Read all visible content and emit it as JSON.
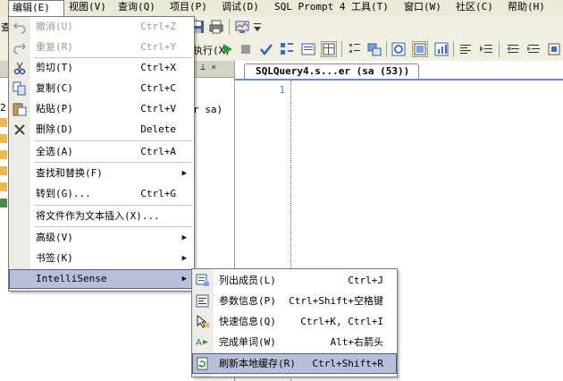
{
  "menubar": {
    "items": [
      "编辑(E)",
      "视图(V)",
      "查询(Q)",
      "项目(P)",
      "调试(D)",
      "SQL Prompt 4",
      "工具(T)",
      "窗口(W)",
      "社区(C)",
      "帮助(H)"
    ]
  },
  "toolbar": {
    "partial_left": "查",
    "execute_label": "执行(X)"
  },
  "left_panel": {
    "pin_glyph": "▾ ⊥ ×",
    "sa_text": "r sa)",
    "partial_label": "2"
  },
  "editor": {
    "tab_title": "SQLQuery4.s...er (sa (53))",
    "line_number": "1"
  },
  "edit_menu": {
    "items": [
      {
        "label": "撤消(U)",
        "shortcut": "Ctrl+Z",
        "icon": "undo-icon"
      },
      {
        "label": "重复(R)",
        "shortcut": "Ctrl+Y",
        "icon": "redo-icon"
      },
      {
        "label": "剪切(T)",
        "shortcut": "Ctrl+X",
        "icon": "cut-icon"
      },
      {
        "label": "复制(C)",
        "shortcut": "Ctrl+C",
        "icon": "copy-icon"
      },
      {
        "label": "粘贴(P)",
        "shortcut": "Ctrl+V",
        "icon": "paste-icon"
      },
      {
        "label": "删除(D)",
        "shortcut": "Delete",
        "icon": "delete-icon"
      },
      {
        "label": "全选(A)",
        "shortcut": "Ctrl+A"
      },
      {
        "label": "查找和替换(F)",
        "arrow": "▶"
      },
      {
        "label": "转到(G)...",
        "shortcut": "Ctrl+G"
      },
      {
        "label": "将文件作为文本插入(X)..."
      },
      {
        "label": "高级(V)",
        "arrow": "▶"
      },
      {
        "label": "书签(K)",
        "arrow": "▶"
      },
      {
        "label": "IntelliSense",
        "arrow": "▶"
      }
    ]
  },
  "intellisense_menu": {
    "items": [
      {
        "label": "列出成员(L)",
        "shortcut": "Ctrl+J",
        "icon": "list-members-icon"
      },
      {
        "label": "参数信息(P)",
        "shortcut": "Ctrl+Shift+空格键",
        "icon": "parameter-info-icon"
      },
      {
        "label": "快速信息(Q)",
        "shortcut": "Ctrl+K, Ctrl+I",
        "icon": "quick-info-icon"
      },
      {
        "label": "完成单词(W)",
        "shortcut": "Alt+右箭头",
        "icon": "complete-word-icon"
      },
      {
        "label": "刷新本地缓存(R)",
        "shortcut": "Ctrl+Shift+R",
        "icon": "refresh-cache-icon"
      }
    ]
  },
  "colors": {
    "menu_highlight": "#b8bfd8",
    "menu_highlight_border": "#4b5c96",
    "line_number": "#2b91af",
    "disabled_text": "#9c9a92"
  }
}
